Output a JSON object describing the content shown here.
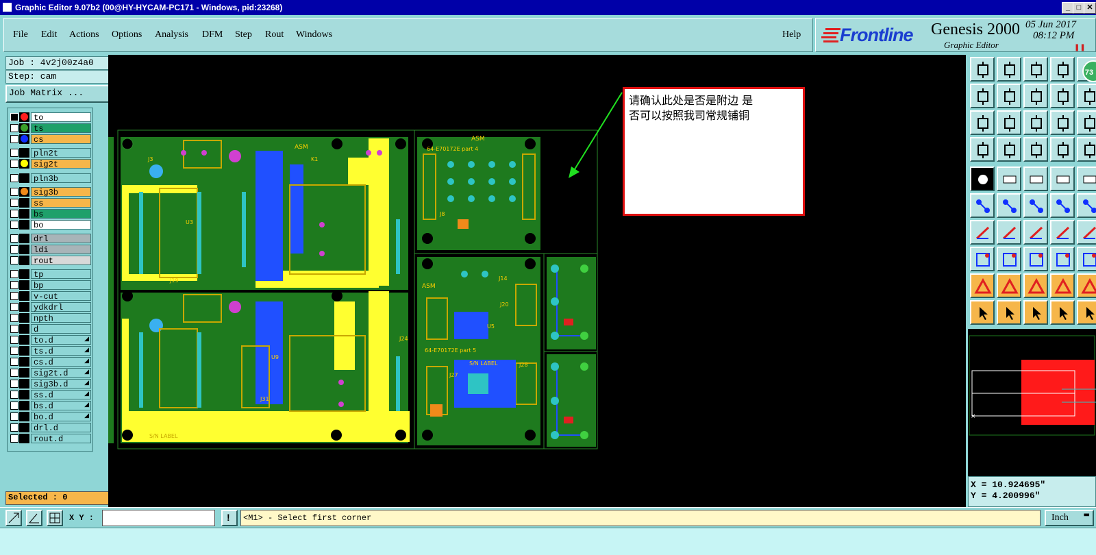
{
  "window": {
    "title": "Graphic Editor 9.07b2 (00@HY-HYCAM-PC171 - Windows, pid:23268)"
  },
  "menu": [
    {
      "label": "File"
    },
    {
      "label": "Edit"
    },
    {
      "label": "Actions"
    },
    {
      "label": "Options"
    },
    {
      "label": "Analysis"
    },
    {
      "label": "DFM"
    },
    {
      "label": "Step"
    },
    {
      "label": "Rout"
    },
    {
      "label": "Windows"
    }
  ],
  "help_label": "Help",
  "brand": {
    "logo": "Frontline",
    "product": "Genesis 2000",
    "subtitle": "Graphic Editor",
    "date": "05 Jun 2017",
    "time": "08:12 PM",
    "badge": "73"
  },
  "job": {
    "job_line": "Job : 4v2j00z4a0",
    "step_line": "Step: cam",
    "matrix_button": "Job Matrix ..."
  },
  "layers": [
    {
      "name": "to",
      "bg": "#ffffff",
      "dot": "#ff2020",
      "sel": true
    },
    {
      "name": "ts",
      "bg": "#1fa06a",
      "dot": "#3aa02a"
    },
    {
      "name": "cs",
      "bg": "#f6b64a",
      "dot": "#1030ff"
    },
    {
      "name": "pln2t",
      "bg": "#8fd6d6",
      "dot": ""
    },
    {
      "name": "sig2t",
      "bg": "#f6b64a",
      "dot": "#ffff00"
    },
    {
      "name": "pln3b",
      "bg": "#8fd6d6",
      "dot": ""
    },
    {
      "name": "sig3b",
      "bg": "#f6b64a",
      "dot": "#f08a1a"
    },
    {
      "name": "ss",
      "bg": "#f6b64a",
      "dot": ""
    },
    {
      "name": "bs",
      "bg": "#1fa06a",
      "dot": ""
    },
    {
      "name": "bo",
      "bg": "#ffffff",
      "dot": ""
    },
    {
      "name": "drl",
      "bg": "#a8b4b8",
      "dot": ""
    },
    {
      "name": "ldi",
      "bg": "#a8b4b8",
      "dot": ""
    },
    {
      "name": "rout",
      "bg": "#d8d8d8",
      "dot": ""
    },
    {
      "name": "tp",
      "bg": "#8fd6d6",
      "dot": ""
    },
    {
      "name": "bp",
      "bg": "#8fd6d6",
      "dot": ""
    },
    {
      "name": "v-cut",
      "bg": "#8fd6d6",
      "dot": ""
    },
    {
      "name": "ydkdrl",
      "bg": "#8fd6d6",
      "dot": ""
    },
    {
      "name": "npth",
      "bg": "#8fd6d6",
      "dot": ""
    },
    {
      "name": "d",
      "bg": "#8fd6d6",
      "dot": ""
    },
    {
      "name": "to.d",
      "bg": "#8fd6d6",
      "dot": "",
      "mark": "◢"
    },
    {
      "name": "ts.d",
      "bg": "#8fd6d6",
      "dot": "",
      "mark": "◢"
    },
    {
      "name": "cs.d",
      "bg": "#8fd6d6",
      "dot": "",
      "mark": "◢"
    },
    {
      "name": "sig2t.d",
      "bg": "#8fd6d6",
      "dot": "",
      "mark": "◢"
    },
    {
      "name": "sig3b.d",
      "bg": "#8fd6d6",
      "dot": "",
      "mark": "◢"
    },
    {
      "name": "ss.d",
      "bg": "#8fd6d6",
      "dot": "",
      "mark": "◢"
    },
    {
      "name": "bs.d",
      "bg": "#8fd6d6",
      "dot": "",
      "mark": "◢"
    },
    {
      "name": "bo.d",
      "bg": "#8fd6d6",
      "dot": "",
      "mark": "◢"
    },
    {
      "name": "drl.d",
      "bg": "#8fd6d6",
      "dot": ""
    },
    {
      "name": "rout.d",
      "bg": "#8fd6d6",
      "dot": ""
    }
  ],
  "selected": "Selected : 0",
  "annotation": {
    "line1": "请确认此处是否是附边 是",
    "line2": "否可以按照我司常规铺铜"
  },
  "board_labels": {
    "asm1": "ASM",
    "asm2": "ASM",
    "asm3": "ASM",
    "part4": "64-E70172E part 4",
    "part5": "64-E70172E part 5",
    "sn1": "S/N LABEL",
    "sn2": "S/N LABEL",
    "j3": "J3",
    "j19": "J19",
    "j31": "J31",
    "j8": "J8",
    "j14": "J14",
    "j20": "J20",
    "j28": "J28",
    "j27": "J27",
    "j24": "J24",
    "u3": "U3",
    "u5": "U5",
    "u9": "U9",
    "k1": "K1"
  },
  "coords": {
    "x": "X = 10.924695\"",
    "y": "Y = 4.200996\""
  },
  "bottom": {
    "xy_label": "X Y :",
    "xy_value": "",
    "prompt": "<M1> - Select first corner",
    "units": "Inch"
  },
  "colors": {
    "pcb_green": "#1e7a1e",
    "copper_yellow": "#ffff30",
    "pad_blue": "#2050ff",
    "accent_teal": "#8fd6d6"
  }
}
